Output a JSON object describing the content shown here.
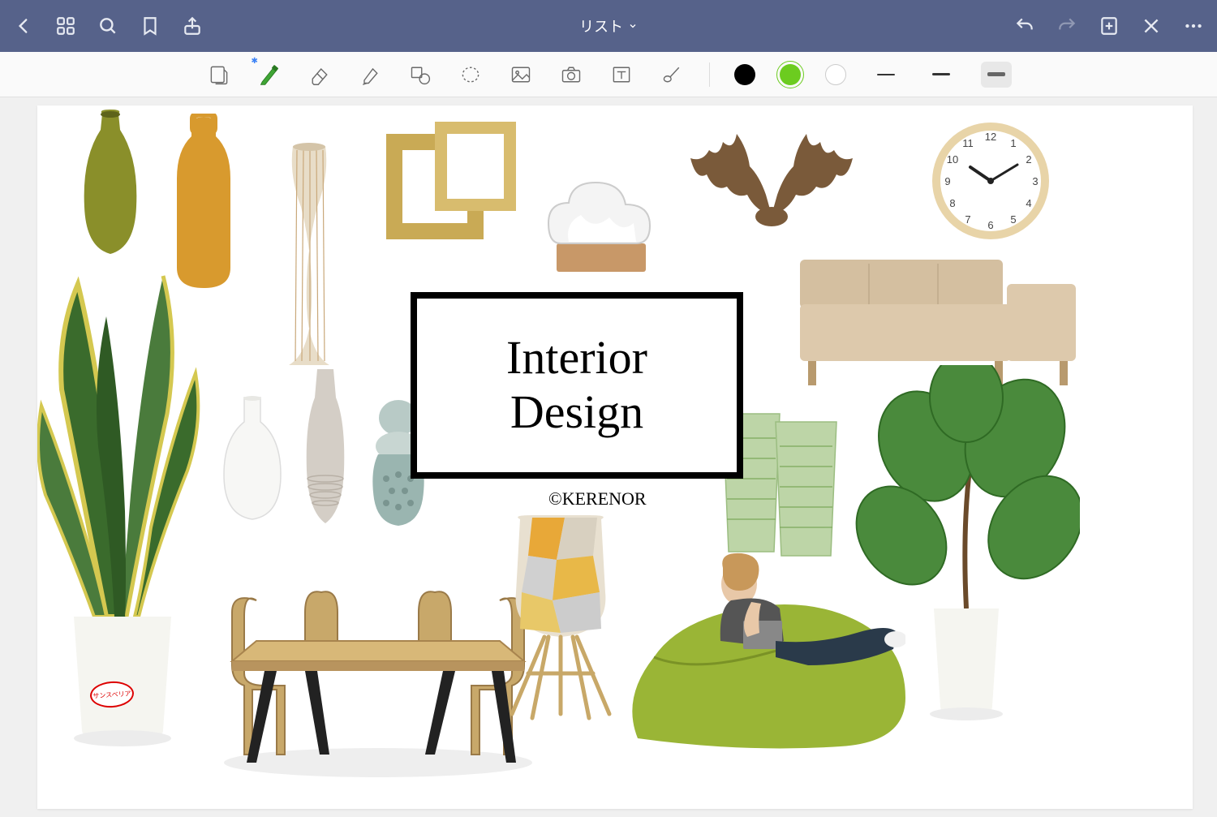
{
  "titlebar": {
    "title": "リスト",
    "icons": {
      "back": "back-icon",
      "grid": "grid-icon",
      "search": "search-icon",
      "bookmark": "bookmark-icon",
      "share": "share-icon",
      "undo": "undo-icon",
      "redo": "redo-icon",
      "newpage": "new-page-icon",
      "close": "close-icon",
      "more": "more-icon"
    }
  },
  "toolbar": {
    "tools": [
      {
        "name": "page-template-tool",
        "label": "Page"
      },
      {
        "name": "pen-tool",
        "label": "Pen",
        "active": true,
        "bluetooth": true,
        "color": "#3fa535"
      },
      {
        "name": "eraser-tool",
        "label": "Eraser"
      },
      {
        "name": "highlighter-tool",
        "label": "Highlighter"
      },
      {
        "name": "shape-tool",
        "label": "Shape"
      },
      {
        "name": "lasso-tool",
        "label": "Lasso"
      },
      {
        "name": "image-tool",
        "label": "Image"
      },
      {
        "name": "camera-tool",
        "label": "Camera"
      },
      {
        "name": "text-tool",
        "label": "Text"
      },
      {
        "name": "pointer-tool",
        "label": "Pointer"
      }
    ],
    "colors": [
      {
        "name": "color-black",
        "hex": "#000000"
      },
      {
        "name": "color-green",
        "hex": "#6ccc1f",
        "selected": true
      },
      {
        "name": "color-white",
        "hex": "#ffffff"
      }
    ],
    "thickness_selected_index": 2
  },
  "canvas": {
    "title_line1": "Interior",
    "title_line2": "Design",
    "credit": "©KERENOR",
    "clock": {
      "numbers": [
        "12",
        "1",
        "2",
        "3",
        "4",
        "5",
        "6",
        "7",
        "8",
        "9",
        "10",
        "11"
      ],
      "time_display": "10:10"
    },
    "plant_tag": "サンスベリア",
    "items": [
      {
        "name": "vase-olive",
        "label": "olive green vase"
      },
      {
        "name": "bottle-mustard",
        "label": "mustard water bottle"
      },
      {
        "name": "vase-striped",
        "label": "tall striped vase"
      },
      {
        "name": "picture-frames",
        "label": "gold picture frames"
      },
      {
        "name": "cloud-storm-glass",
        "label": "cloud storm glass"
      },
      {
        "name": "antler-decor",
        "label": "deer antler wall decor"
      },
      {
        "name": "wall-clock",
        "label": "wooden wall clock"
      },
      {
        "name": "snake-plant",
        "label": "snake plant in white pot"
      },
      {
        "name": "vase-white-bulb",
        "label": "white bulbous vase"
      },
      {
        "name": "vase-grey-ribbed",
        "label": "grey ribbed vase"
      },
      {
        "name": "vase-teal-pattern",
        "label": "teal patterned vase"
      },
      {
        "name": "beige-sofa",
        "label": "beige L-shaped sofa"
      },
      {
        "name": "green-glasses",
        "label": "pair of green glasses"
      },
      {
        "name": "fiddle-plant",
        "label": "large leaf plant in white pot"
      },
      {
        "name": "dining-table-set",
        "label": "wooden dining table with chairs"
      },
      {
        "name": "eames-chair",
        "label": "patchwork Eames chair"
      },
      {
        "name": "green-beanbag",
        "label": "woman on green bean bag"
      }
    ]
  }
}
